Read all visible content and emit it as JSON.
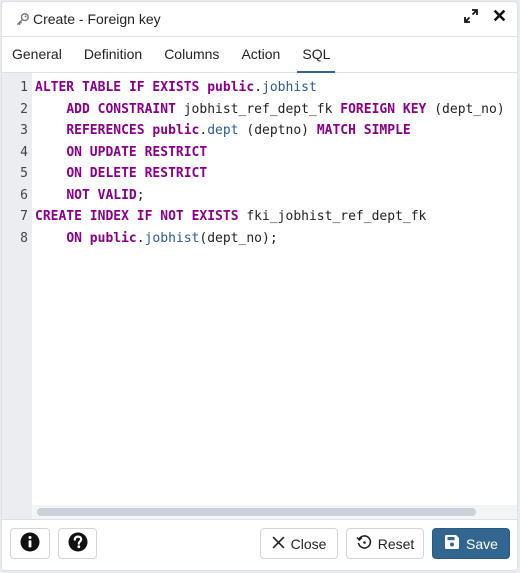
{
  "dialog": {
    "title": "Create - Foreign key",
    "title_icon": "key-icon",
    "actions": {
      "maximize": "expand-icon",
      "close": "close-icon"
    }
  },
  "tabs": [
    {
      "label": "General",
      "active": false
    },
    {
      "label": "Definition",
      "active": false
    },
    {
      "label": "Columns",
      "active": false
    },
    {
      "label": "Action",
      "active": false
    },
    {
      "label": "SQL",
      "active": true
    }
  ],
  "sql": {
    "line_numbers": [
      "1",
      "2",
      "3",
      "4",
      "5",
      "6",
      "7",
      "8"
    ],
    "lines": [
      "ALTER TABLE IF EXISTS public.jobhist",
      "    ADD CONSTRAINT jobhist_ref_dept_fk FOREIGN KEY (dept_no)",
      "    REFERENCES public.dept (deptno) MATCH SIMPLE",
      "    ON UPDATE RESTRICT",
      "    ON DELETE RESTRICT",
      "    NOT VALID;",
      "CREATE INDEX IF NOT EXISTS fki_jobhist_ref_dept_fk",
      "    ON public.jobhist(dept_no);"
    ]
  },
  "footer": {
    "info_icon": "info-icon",
    "help_icon": "help-icon",
    "close_label": "Close",
    "reset_label": "Reset",
    "save_label": "Save"
  },
  "colors": {
    "accent": "#326690",
    "keyword": "#8b008b",
    "identifier": "#2a5a94"
  }
}
